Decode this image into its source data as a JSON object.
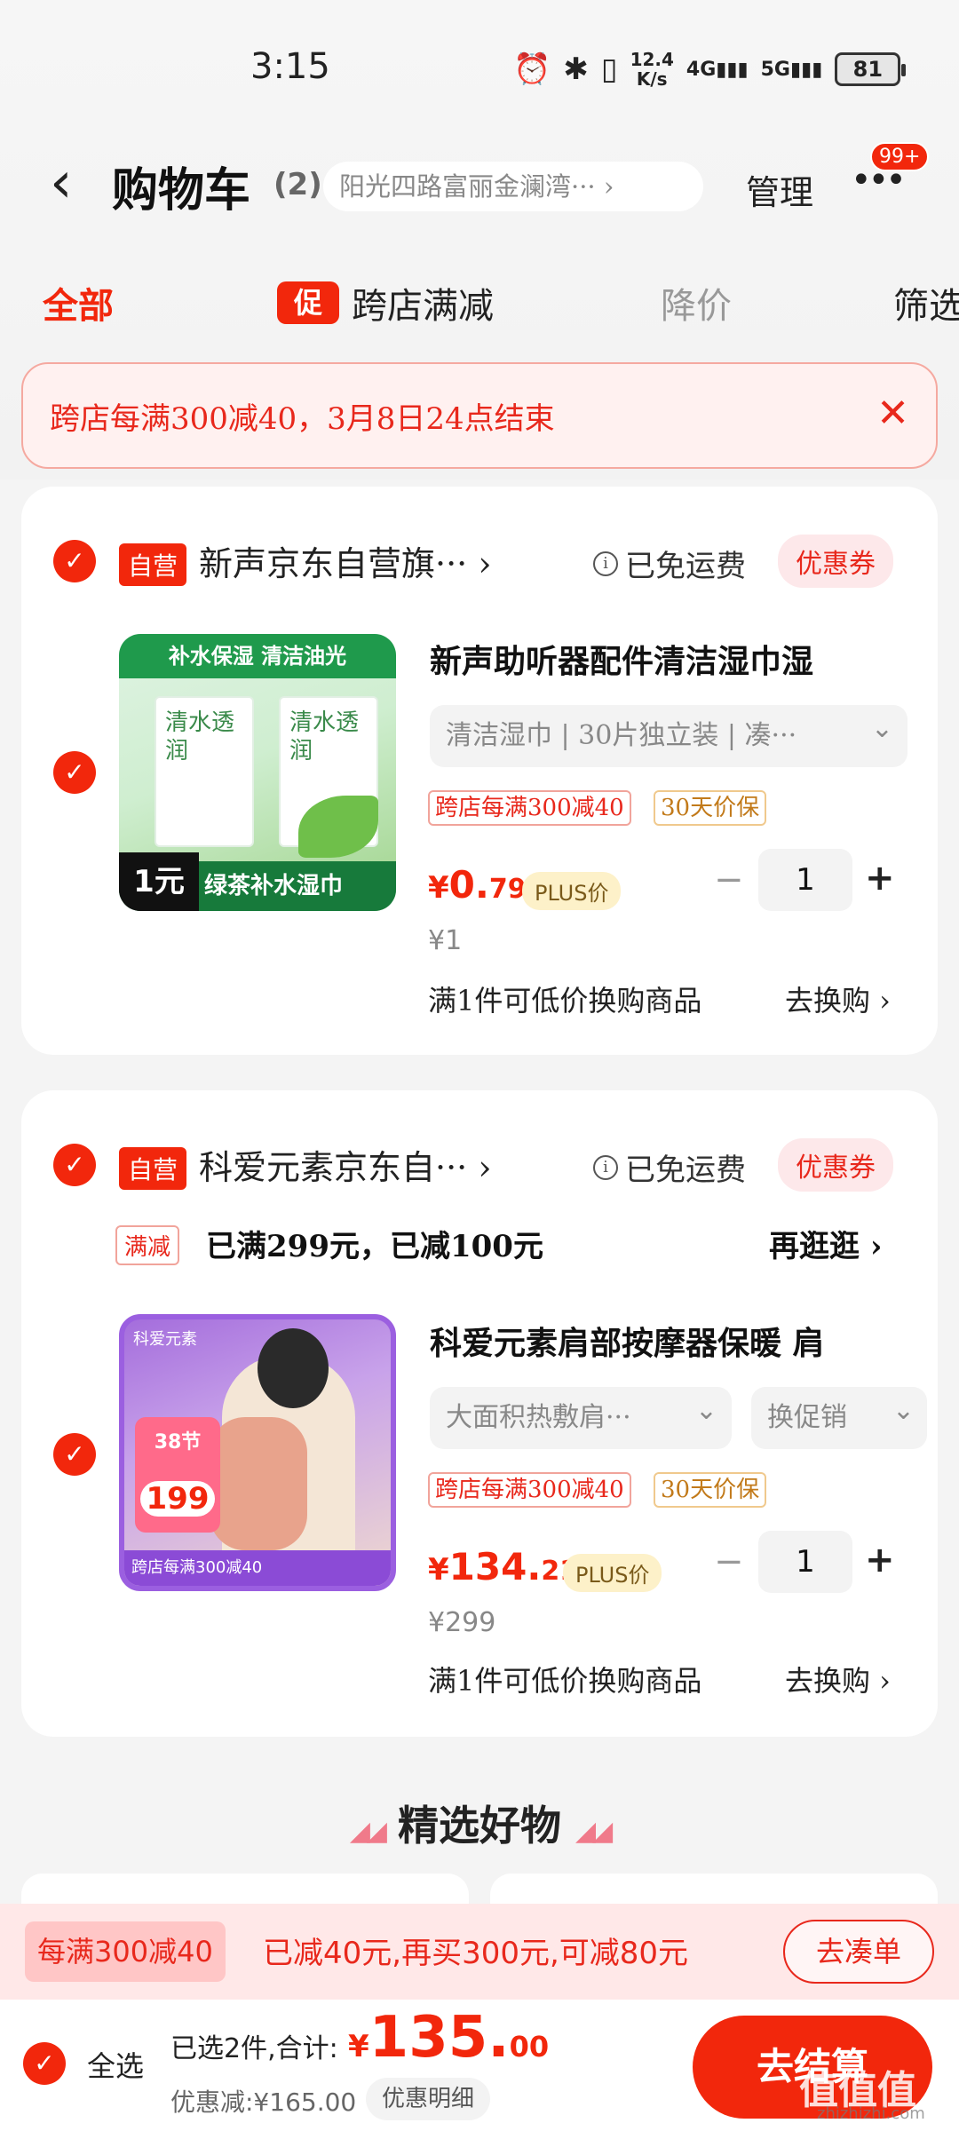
{
  "status_bar": {
    "time": "3:15",
    "net_speed_top": "12.4",
    "net_speed_bottom": "K/s",
    "signal_1": "4G",
    "signal_2": "5G",
    "battery": "81"
  },
  "header": {
    "back_icon": "chevron-left",
    "title": "购物车",
    "count": "(2)",
    "address": "阳光四路富丽金澜湾··· ›",
    "manage": "管理",
    "more_badge": "99+"
  },
  "tabs": {
    "all": "全部",
    "cu_icon": "促",
    "cross_store": "跨店满减",
    "price_drop": "降价",
    "filter": "筛选"
  },
  "promo_banner": {
    "text": "跨店每满300减40，3月8日24点结束",
    "close_icon": "close"
  },
  "stores": [
    {
      "self_operated": "自营",
      "name": "新声京东自营旗··· ›",
      "free_shipping": "已免运费",
      "coupon": "优惠券",
      "item": {
        "title": "新声助听器配件清洁湿巾湿",
        "spec": "清洁湿巾 | 30片独立装 | 凑···",
        "tag_1": "跨店每满300减40",
        "tag_2": "30天价保",
        "price_yen": "¥",
        "price_int": "0.",
        "price_dec": "79",
        "plus_label": "PLUS价",
        "qty": "1",
        "orig_price": "¥1",
        "swap_text": "满1件可低价换购商品",
        "swap_link": "去换购 ›",
        "thumb": {
          "top": "补水保湿 清洁油光",
          "box_text": "清水透润",
          "price": "1元",
          "bottom": "绿茶补水湿巾"
        }
      }
    },
    {
      "self_operated": "自营",
      "name": "科爱元素京东自··· ›",
      "free_shipping": "已免运费",
      "coupon": "优惠券",
      "mj_tag": "满减",
      "mj_text": "已满299元，已减100元",
      "mj_link": "再逛逛 ›",
      "item": {
        "title": "科爱元素肩部按摩器保暖 肩",
        "spec": "大面积热敷肩···",
        "promo_select": "换促销",
        "tag_1": "跨店每满300减40",
        "tag_2": "30天价保",
        "price_yen": "¥",
        "price_int": "134.",
        "price_dec": "21",
        "plus_label": "PLUS价",
        "qty": "1",
        "orig_price": "¥299",
        "swap_text": "满1件可低价换购商品",
        "swap_link": "去换购 ›",
        "thumb": {
          "brand": "科爱元素",
          "badge_top": "38节",
          "badge_price": "199",
          "bottom": "跨店每满300减40"
        }
      }
    }
  ],
  "recommend": {
    "title": "精选好物"
  },
  "promo_strip": {
    "tag": "每满300减40",
    "text": "已减40元,再买300元,可减80元",
    "button": "去凑单"
  },
  "bottom_bar": {
    "select_all": "全选",
    "selected": "已选2件,合计:",
    "total_yen": "¥",
    "total_int": "135.",
    "total_dec": "00",
    "discount": "优惠减:¥165.00",
    "detail": "优惠明细",
    "checkout": "去结算",
    "watermark": "值值值",
    "watermark_sub": "zhizhizhi.com"
  },
  "colors": {
    "accent": "#f2270c",
    "banner_bg": "#fff1f0",
    "strip_bg": "#ffe8e8",
    "plus_bg": "#fdf1c9"
  }
}
